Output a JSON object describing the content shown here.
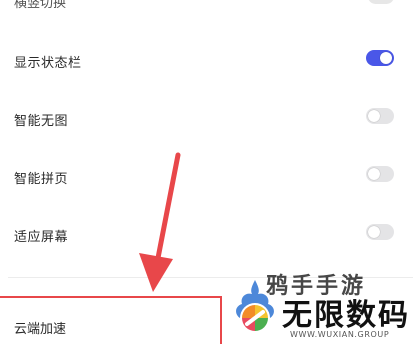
{
  "settings": {
    "partial_row": {
      "label": "横竖切换"
    },
    "rows": [
      {
        "label": "显示状态栏",
        "enabled": true
      },
      {
        "label": "智能无图",
        "enabled": false
      },
      {
        "label": "智能拼页",
        "enabled": false
      },
      {
        "label": "适应屏幕",
        "enabled": false
      }
    ],
    "cloud_row": {
      "label": "云端加速"
    }
  },
  "colors": {
    "toggle_on": "#4a57e8",
    "toggle_off": "#e4e4e6",
    "annotation": "#e8474a"
  },
  "watermark": {
    "top_text": "鸦手手游",
    "main_text": "无限数码",
    "sub_text": "WWW.WUXIAN.GROUP"
  }
}
